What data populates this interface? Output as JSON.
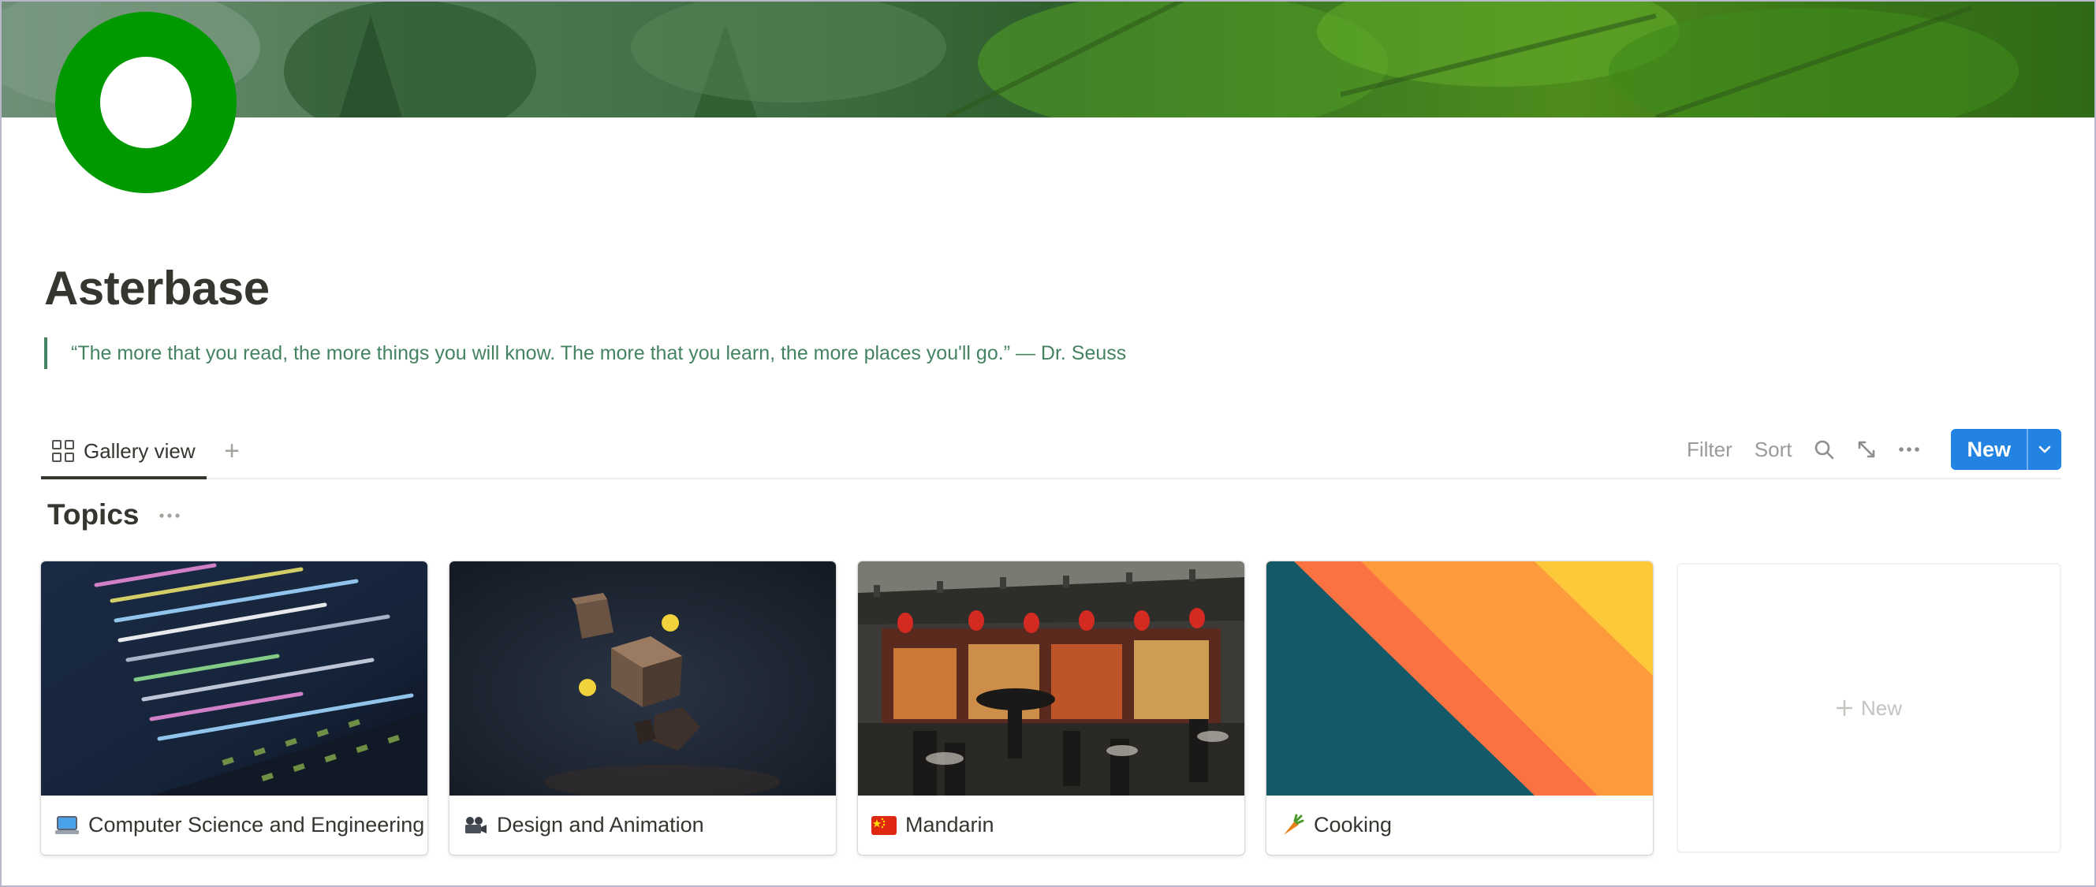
{
  "page": {
    "title": "Asterbase",
    "quote": "“The more that you read, the more things you will know. The more that you learn, the more places you'll go.” — Dr. Seuss",
    "cover": "pine-branches-photo",
    "icon": "green-ring-icon"
  },
  "view_bar": {
    "tab_label": "Gallery view",
    "add_view": "+",
    "filter_label": "Filter",
    "sort_label": "Sort",
    "new_label": "New"
  },
  "section": {
    "title": "Topics"
  },
  "cards": [
    {
      "title": "Computer Science and Engineering",
      "icon": "laptop-icon"
    },
    {
      "title": "Design and Animation",
      "icon": "movie-camera-icon"
    },
    {
      "title": "Mandarin",
      "icon": "china-flag-icon"
    },
    {
      "title": "Cooking",
      "icon": "carrot-icon"
    }
  ],
  "new_card": {
    "label": "New"
  },
  "colors": {
    "accent": "#2383e2",
    "quote": "#448361",
    "icon_green": "#009900"
  }
}
